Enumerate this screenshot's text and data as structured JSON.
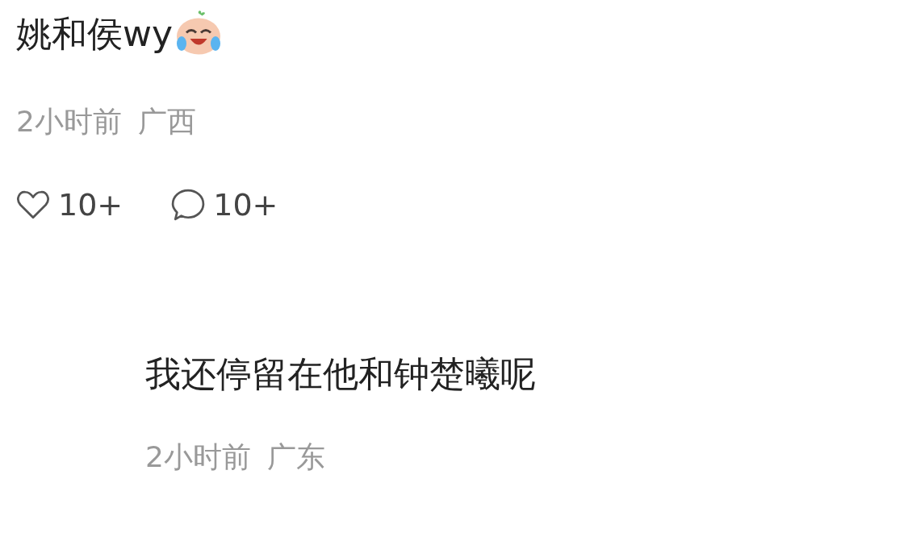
{
  "comments": [
    {
      "text": "姚和侯wy",
      "emoji": true,
      "time": "2小时前",
      "location": "广西",
      "likes": "10+",
      "replies": "10+",
      "children": [
        {
          "text": "我还停留在他和钟楚曦呢",
          "emoji": false,
          "time": "2小时前",
          "location": "广东"
        }
      ]
    }
  ]
}
